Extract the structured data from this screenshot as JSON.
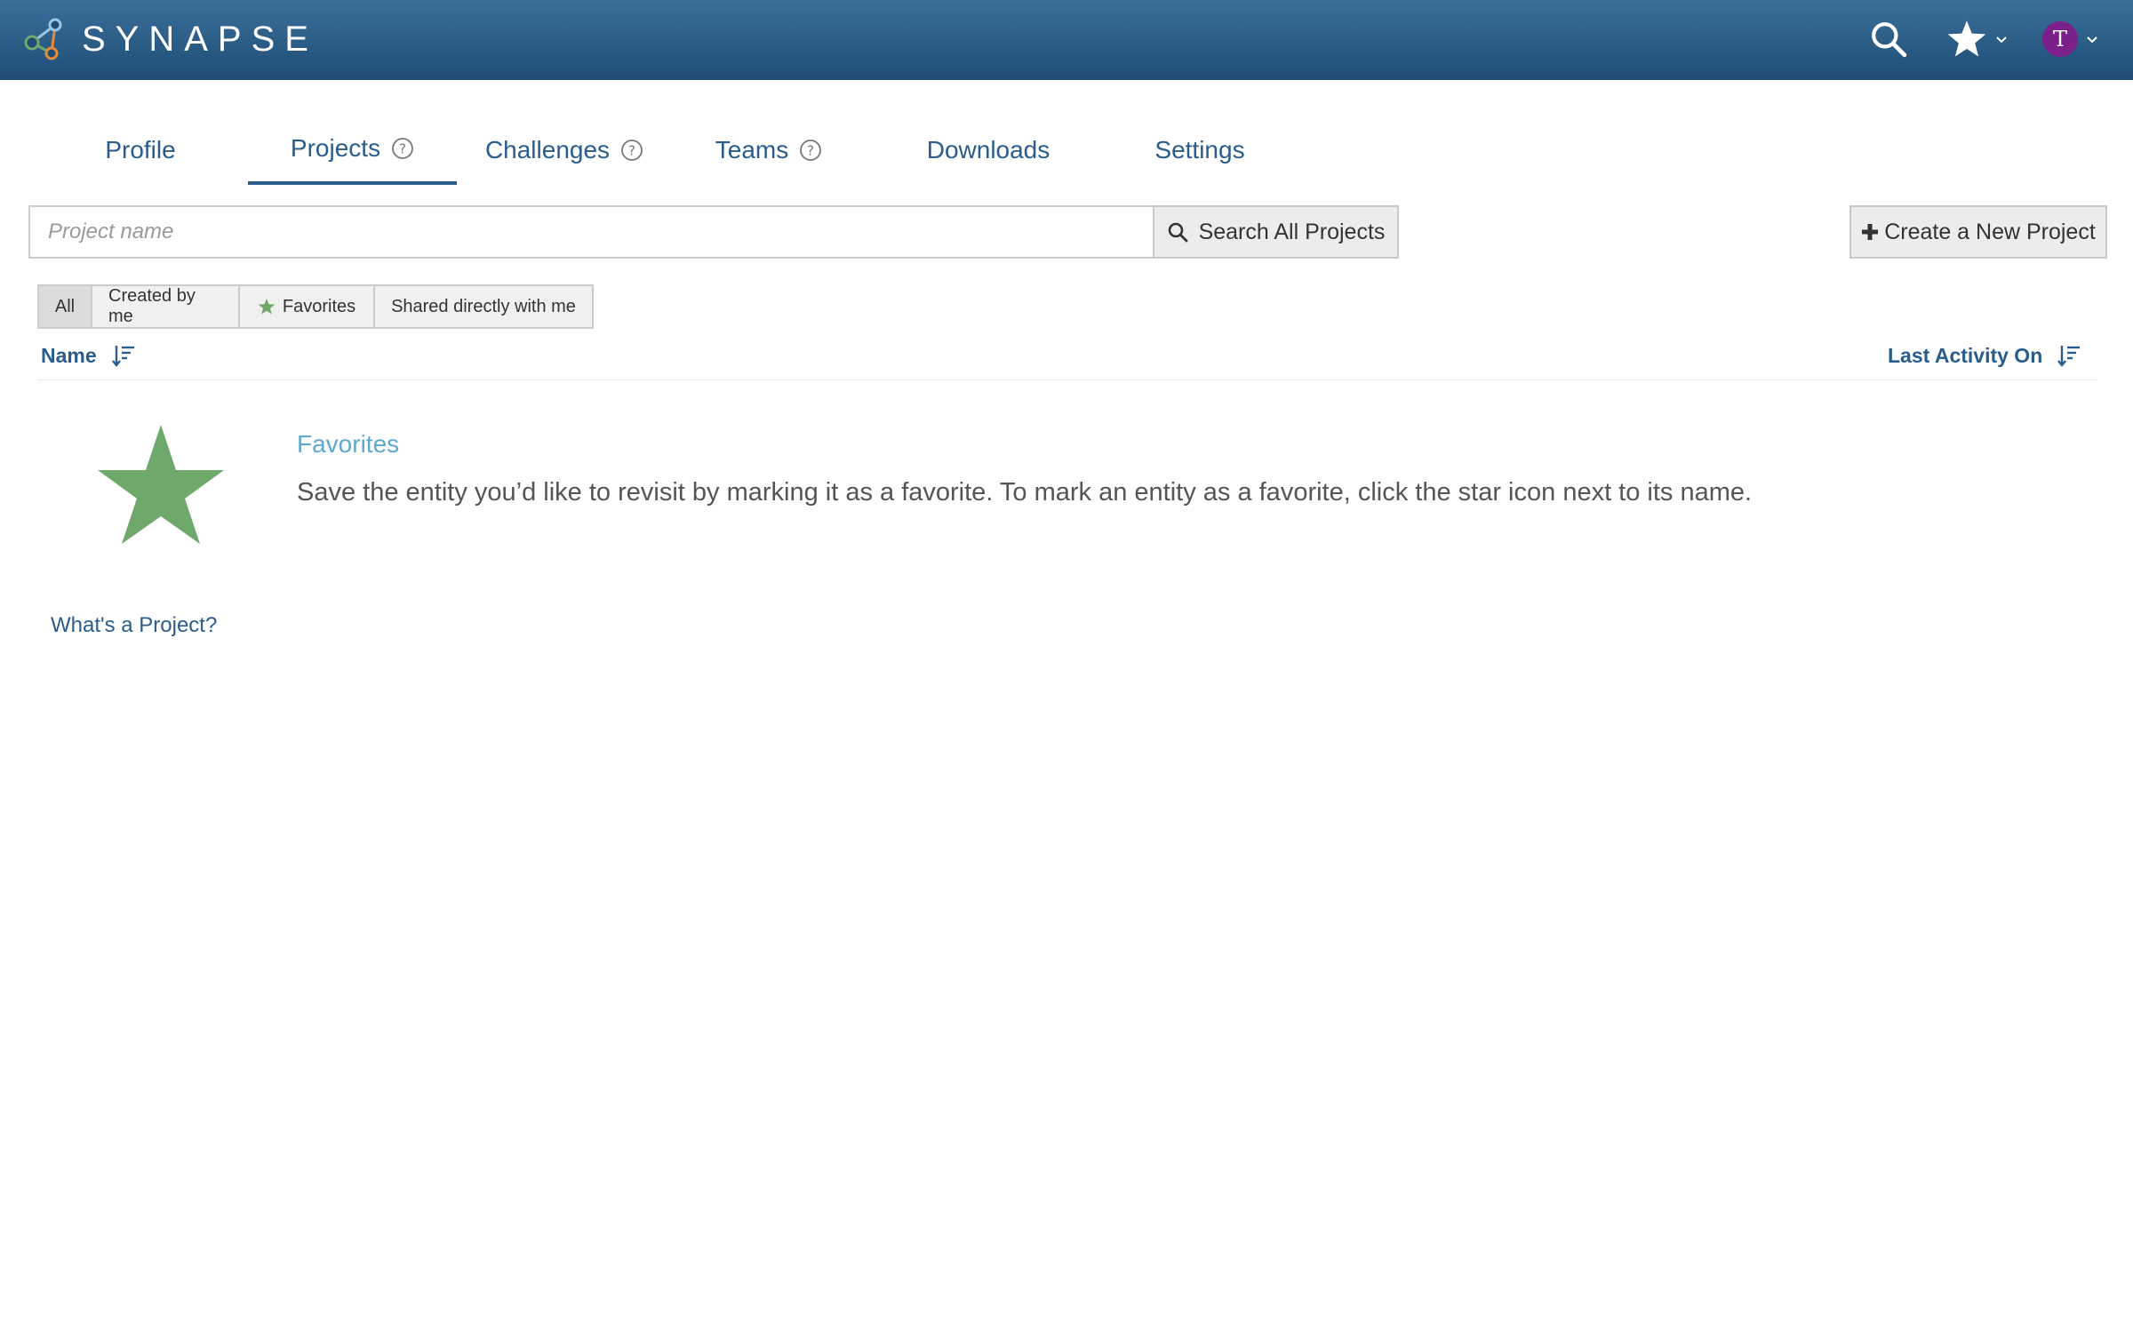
{
  "header": {
    "logo_text": "SYNAPSE",
    "avatar_initial": "T"
  },
  "tabs": [
    {
      "label": "Profile"
    },
    {
      "label": "Projects"
    },
    {
      "label": "Challenges"
    },
    {
      "label": "Teams"
    },
    {
      "label": "Downloads"
    },
    {
      "label": "Settings"
    }
  ],
  "search": {
    "placeholder": "Project name",
    "value": "",
    "button_label": "Search All Projects"
  },
  "create_button_label": "Create a New Project",
  "filters": [
    {
      "label": "All"
    },
    {
      "label": "Created by me"
    },
    {
      "label": "Favorites"
    },
    {
      "label": "Shared directly with me"
    }
  ],
  "columns": {
    "name": "Name",
    "last_activity": "Last Activity On"
  },
  "empty_state": {
    "title": "Favorites",
    "description": "Save the entity you’d like to revisit by marking it as a favorite. To mark an entity as a favorite, click the star icon next to its name."
  },
  "help_link": "What's a Project?",
  "colors": {
    "header": "#2b5f8a",
    "link": "#2a5c8c",
    "star_green": "#6fa86b",
    "avatar": "#7b1f8a",
    "empty_title": "#5fa8cf"
  }
}
